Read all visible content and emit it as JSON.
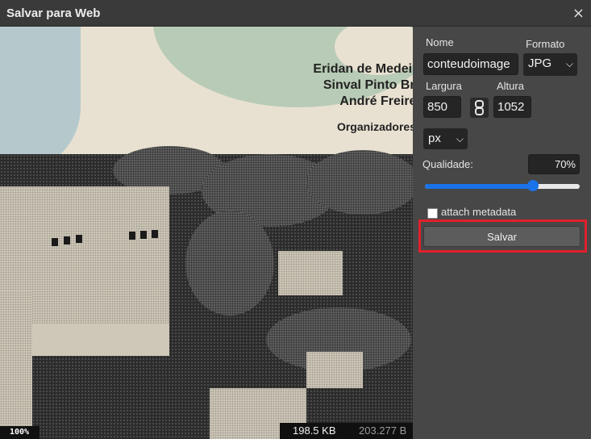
{
  "dialog": {
    "title": "Salvar para Web",
    "close_glyph": "×"
  },
  "preview": {
    "authors": [
      "Eridan de Medeiros C",
      "Sinval Pinto Brandã",
      "André Freire Furt"
    ],
    "organizers": "Organizadores",
    "zoom": "100%",
    "size_new": "198.5 KB",
    "size_orig": "203.277 B"
  },
  "panel": {
    "nome_label": "Nome",
    "nome_value": "conteudoimage",
    "formato_label": "Formato",
    "formato_value": "JPG",
    "largura_label": "Largura",
    "largura_value": "850",
    "altura_label": "Altura",
    "altura_value": "1052",
    "unit_value": "px",
    "quality_label": "Qualidade:",
    "quality_value": "70%",
    "quality_fraction": 0.7,
    "metadata_label": "attach metadata",
    "metadata_checked": false,
    "save_label": "Salvar"
  },
  "icons": {
    "close": "close-icon",
    "chevron": "chevron-down-icon",
    "link": "chain-link-icon"
  },
  "colors": {
    "accent": "#1a73e8",
    "highlight": "#e0202a",
    "panel_bg": "#474747"
  }
}
